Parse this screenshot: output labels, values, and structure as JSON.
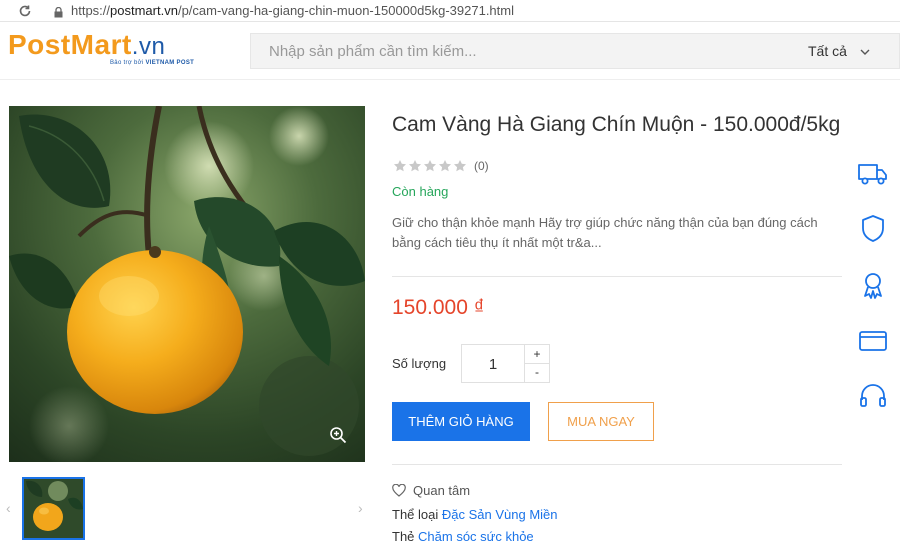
{
  "browser": {
    "url_prefix": "https://",
    "url_host": "postmart.vn",
    "url_path": "/p/cam-vang-ha-giang-chin-muon-150000d5kg-39271.html"
  },
  "header": {
    "logo_post": "PostMart",
    "logo_vn": ".vn",
    "logo_tagline_prefix": "Bảo trợ bởi",
    "logo_tagline_brand": "VIETNAM POST",
    "search_placeholder": "Nhập sản phẩm cần tìm kiếm...",
    "search_category": "Tất cả"
  },
  "product": {
    "title": "Cam Vàng Hà Giang Chín Muộn - 150.000đ/5kg",
    "rating_stars": 0,
    "rating_max": 5,
    "review_count": "(0)",
    "stock_status": "Còn hàng",
    "description": "Giữ cho thận khỏe mạnh Hãy trợ giúp chức năng thận của bạn đúng cách bằng cách tiêu thụ ít nhất một tr&a...",
    "price": "150.000 ₫",
    "quantity_label": "Số lượng",
    "quantity": "1",
    "qty_plus": "+",
    "qty_minus": "-",
    "add_to_cart": "THÊM GIỎ HÀNG",
    "buy_now": "MUA NGAY",
    "favorite_label": "Quan tâm",
    "category_label": "Thể loại",
    "category_value": "Đặc Sản Vùng Miền",
    "tag_label": "Thẻ",
    "tag_value": "Chăm sóc sức khỏe"
  },
  "gallery": {
    "prev": "‹",
    "next": "›"
  },
  "rail": [
    "truck-icon",
    "shield-icon",
    "award-icon",
    "card-icon",
    "headset-icon"
  ],
  "colors": {
    "accent": "#1a73e8",
    "price": "#e5452b",
    "stock": "#26a65b",
    "logo_orange": "#f39a1d",
    "logo_blue": "#1e5aa8"
  }
}
